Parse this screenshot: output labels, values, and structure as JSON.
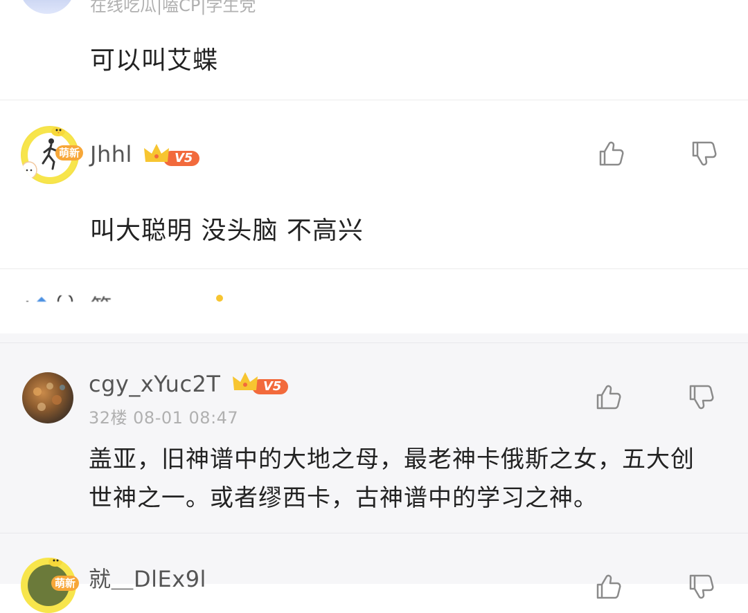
{
  "comments": [
    {
      "id": "top-partial",
      "subtitle": "在线吃瓜|嗑CP|学生党",
      "text": "可以叫艾蝶"
    },
    {
      "id": "jhhl",
      "username": "Jhhl",
      "avatar_tag": "萌新",
      "level": "V5",
      "text": "叫大聪明 没头脑 不高兴"
    },
    {
      "id": "partial-mid",
      "username": "简..."
    },
    {
      "id": "cgy",
      "username": "cgy_xYuc2T",
      "level": "V5",
      "meta": "32楼 08-01 08:47",
      "text_line1": "盖亚，旧神谱中的大地之母，最老神卡俄斯之女，五大创",
      "text_line2": "世神之一。或者缪西卡，古神谱中的学习之神。"
    },
    {
      "id": "bottom-partial",
      "username": "就＿DlEx9l",
      "avatar_tag": "萌新"
    }
  ],
  "icons": {
    "like": "thumbs-up-icon",
    "dislike": "thumbs-down-icon",
    "vip": "crown-icon"
  },
  "colors": {
    "accent_orange": "#f26a3c",
    "crown_gold": "#f7c531",
    "panel_bg": "#f6f6f8"
  }
}
